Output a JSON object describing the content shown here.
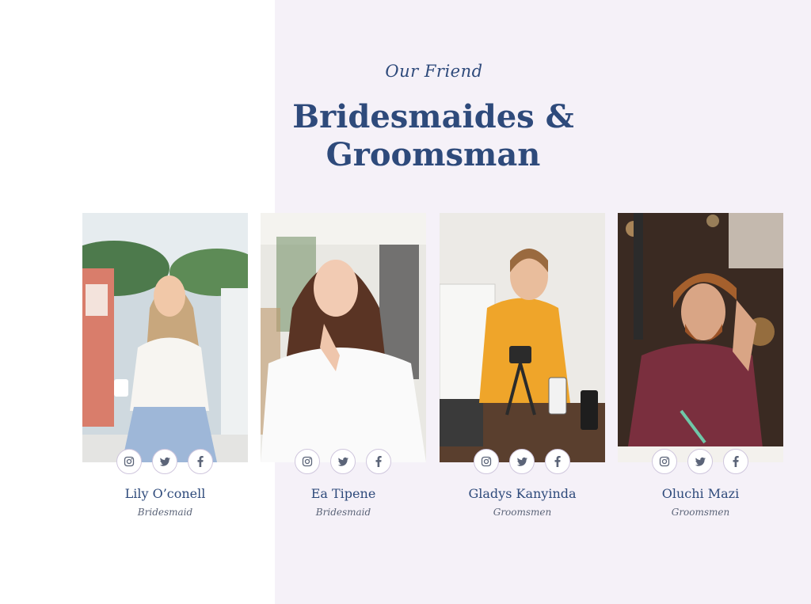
{
  "section": {
    "eyebrow": "Our Friend",
    "title_line1": "Bridesmaides &",
    "title_line2": "Groomsman"
  },
  "colors": {
    "primary": "#2e4a7b",
    "panel_bg": "#f5f1f8",
    "muted": "#5b6478"
  },
  "social_icons": [
    "instagram-icon",
    "twitter-icon",
    "facebook-icon"
  ],
  "members": [
    {
      "name": "Lily O’conell",
      "role": "Bridesmaid"
    },
    {
      "name": "Ea Tipene",
      "role": "Bridesmaid"
    },
    {
      "name": "Gladys Kanyinda",
      "role": "Groomsmen"
    },
    {
      "name": "Oluchi Mazi",
      "role": "Groomsmen"
    }
  ]
}
